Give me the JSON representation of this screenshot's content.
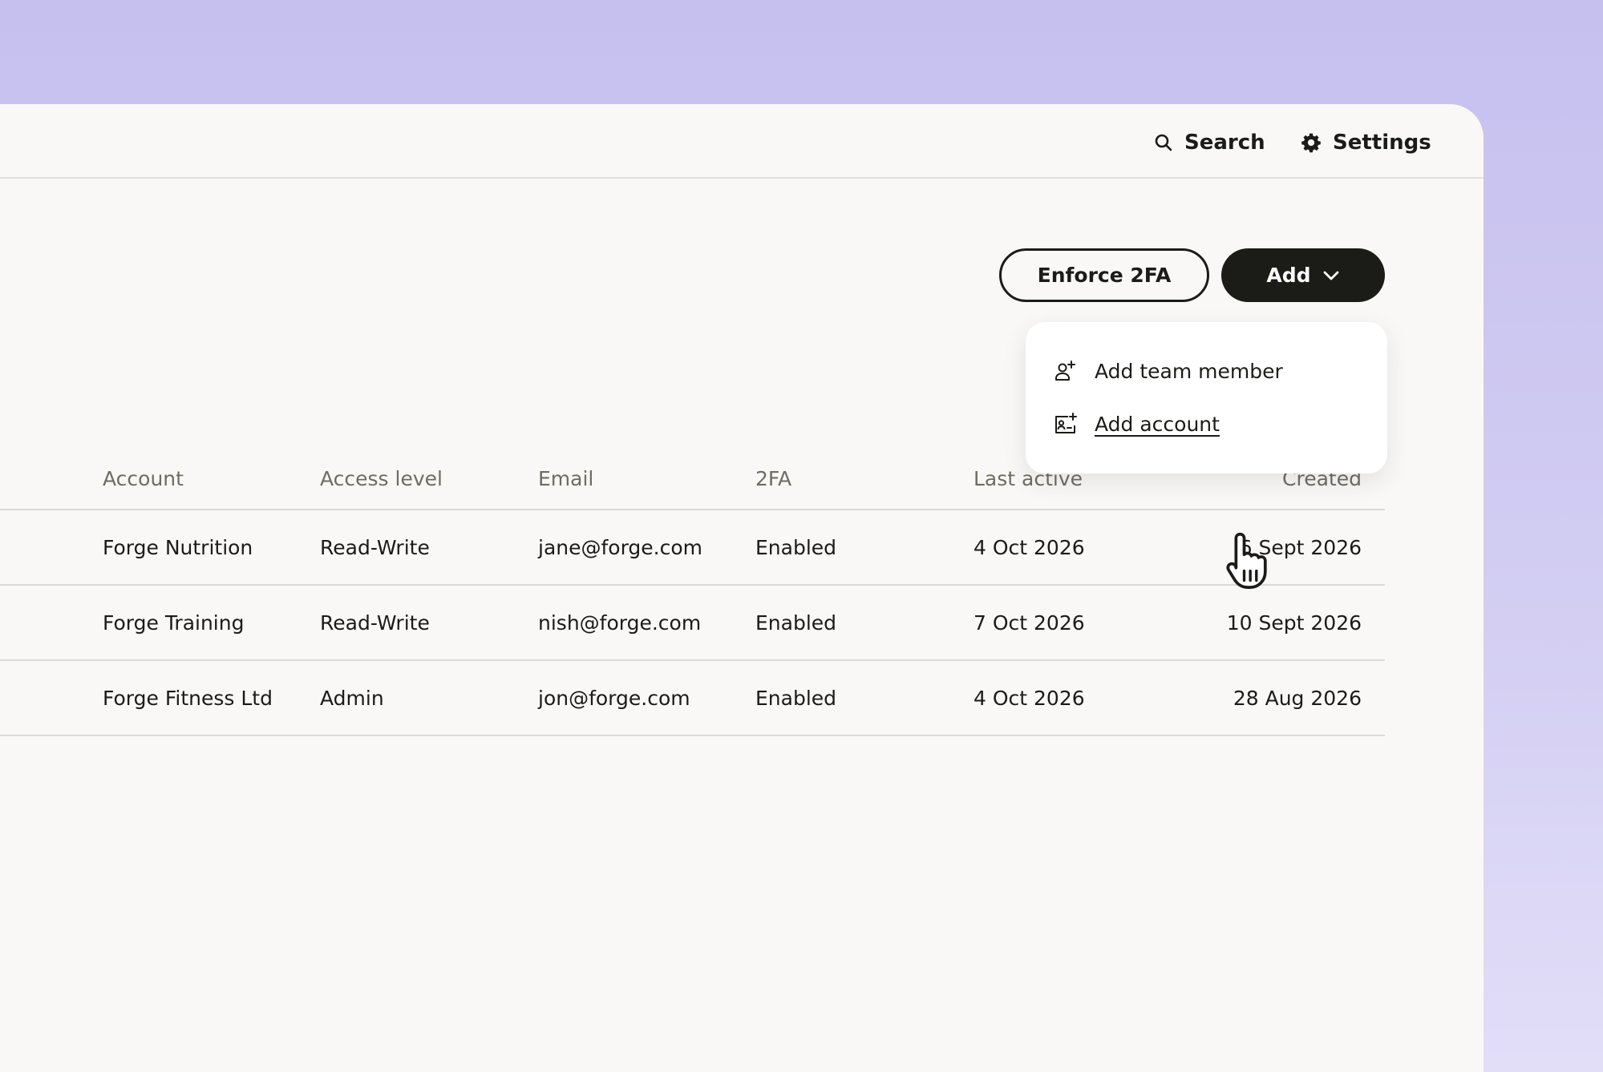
{
  "topbar": {
    "search_label": "Search",
    "settings_label": "Settings"
  },
  "actions": {
    "enforce_label": "Enforce 2FA",
    "add_label": "Add"
  },
  "add_menu": {
    "items": [
      {
        "label": "Add team member",
        "icon": "user-plus-icon"
      },
      {
        "label": "Add account",
        "icon": "id-card-plus-icon"
      }
    ]
  },
  "table": {
    "headers": [
      "Account",
      "Access level",
      "Email",
      "2FA",
      "Last active",
      "Created"
    ],
    "rows": [
      [
        "Forge Nutrition",
        "Read-Write",
        "jane@forge.com",
        "Enabled",
        "4 Oct 2026",
        "6 Sept 2026"
      ],
      [
        "Forge Training",
        "Read-Write",
        "nish@forge.com",
        "Enabled",
        "7 Oct 2026",
        "10 Sept 2026"
      ],
      [
        "Forge Fitness Ltd",
        "Admin",
        "jon@forge.com",
        "Enabled",
        "4 Oct 2026",
        "28 Aug 2026"
      ]
    ]
  },
  "colors": {
    "background": "#c6c0ef",
    "panel": "#f9f8f6",
    "primary_button": "#1b1b18",
    "header_text": "#6f6c64"
  }
}
